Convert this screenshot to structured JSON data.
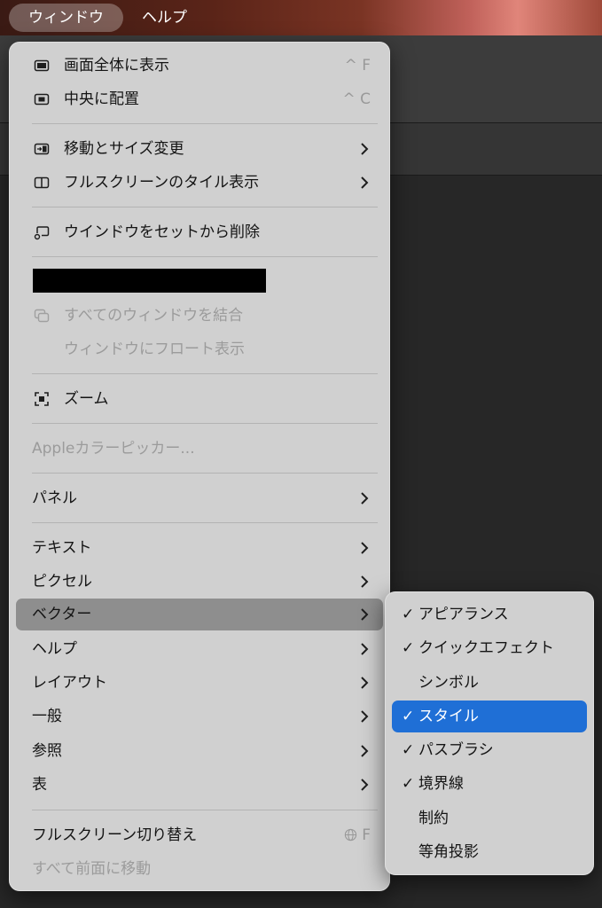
{
  "menubar": {
    "window": "ウィンドウ",
    "help": "ヘルプ"
  },
  "window_menu": {
    "fullscreen_fill": {
      "label": "画面全体に表示",
      "shortcut": "^ F"
    },
    "center": {
      "label": "中央に配置",
      "shortcut": "^ C"
    },
    "move_resize": "移動とサイズ変更",
    "fullscreen_tile": "フルスクリーンのタイル表示",
    "remove_from_set": "ウインドウをセットから削除",
    "merge_all": "すべてのウィンドウを結合",
    "float": "ウィンドウにフロート表示",
    "zoom": "ズーム",
    "color_picker": "Appleカラーピッカー...",
    "panel": "パネル",
    "text": "テキスト",
    "pixel": "ピクセル",
    "vector": "ベクター",
    "help": "ヘルプ",
    "layout": "レイアウト",
    "general": "一般",
    "reference": "参照",
    "table": "表",
    "toggle_fullscreen": {
      "label": "フルスクリーン切り替え",
      "shortcut": "F"
    },
    "bring_all_front": "すべて前面に移動"
  },
  "vector_submenu": [
    {
      "label": "アピアランス",
      "checked": true
    },
    {
      "label": "クイックエフェクト",
      "checked": true
    },
    {
      "label": "シンボル",
      "checked": false
    },
    {
      "label": "スタイル",
      "checked": true
    },
    {
      "label": "パスブラシ",
      "checked": true
    },
    {
      "label": "境界線",
      "checked": true
    },
    {
      "label": "制約",
      "checked": false
    },
    {
      "label": "等角投影",
      "checked": false
    }
  ],
  "checkmark": "✓",
  "colors": {
    "highlight": "#8e8e8e",
    "selected": "#1f6fd6",
    "menu_bg": "#d0d0d0"
  }
}
